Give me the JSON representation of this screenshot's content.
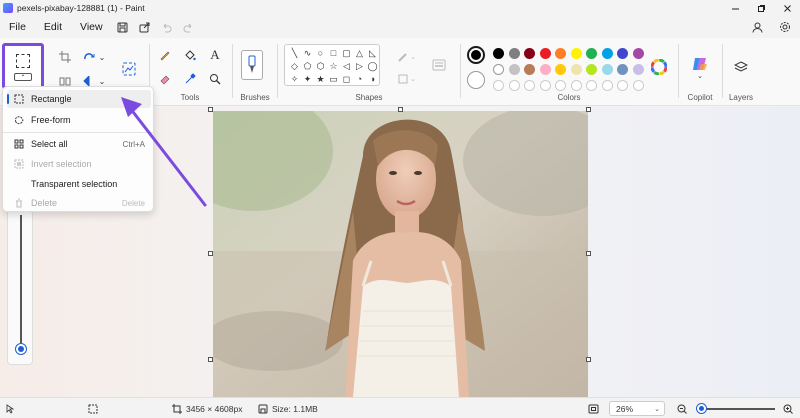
{
  "window": {
    "title": "pexels-pixabay-128881 (1) - Paint"
  },
  "menu": {
    "file": "File",
    "edit": "Edit",
    "view": "View"
  },
  "ribbon": {
    "groups": {
      "tools": "Tools",
      "brushes": "Brushes",
      "shapes": "Shapes",
      "colors": "Colors",
      "copilot": "Copilot",
      "layers": "Layers"
    },
    "shapes": [
      "╲",
      "∿",
      "○",
      "□",
      "▢",
      "△",
      "◺",
      "◇",
      "⬠",
      "⬡",
      "☆",
      "◁",
      "▷",
      "◯",
      "✧",
      "✦",
      "★",
      "▭",
      "◻",
      "◔",
      "◑",
      "∽",
      "∽"
    ],
    "colors": {
      "primary": "#000000",
      "row1": [
        "#000000",
        "#7f7f7f",
        "#880015",
        "#ed1c24",
        "#ff7f27",
        "#fff200",
        "#22b14c",
        "#00a2e8",
        "#3f48cc",
        "#a349a4"
      ],
      "row2": [
        "#ffffff",
        "#c3c3c3",
        "#b97a57",
        "#ffaec9",
        "#ffc90e",
        "#efe4b0",
        "#b5e61d",
        "#99d9ea",
        "#7092be",
        "#c8bfe7"
      ]
    }
  },
  "dropdown": {
    "rectangle": "Rectangle",
    "freeform": "Free-form",
    "select_all": "Select all",
    "select_all_shortcut": "Ctrl+A",
    "invert_selection": "Invert selection",
    "transparent_selection": "Transparent selection",
    "delete": "Delete",
    "delete_shortcut": "Delete"
  },
  "status": {
    "dimensions": "3456 × 4608px",
    "size": "Size: 1.1MB",
    "zoom": "26%"
  }
}
